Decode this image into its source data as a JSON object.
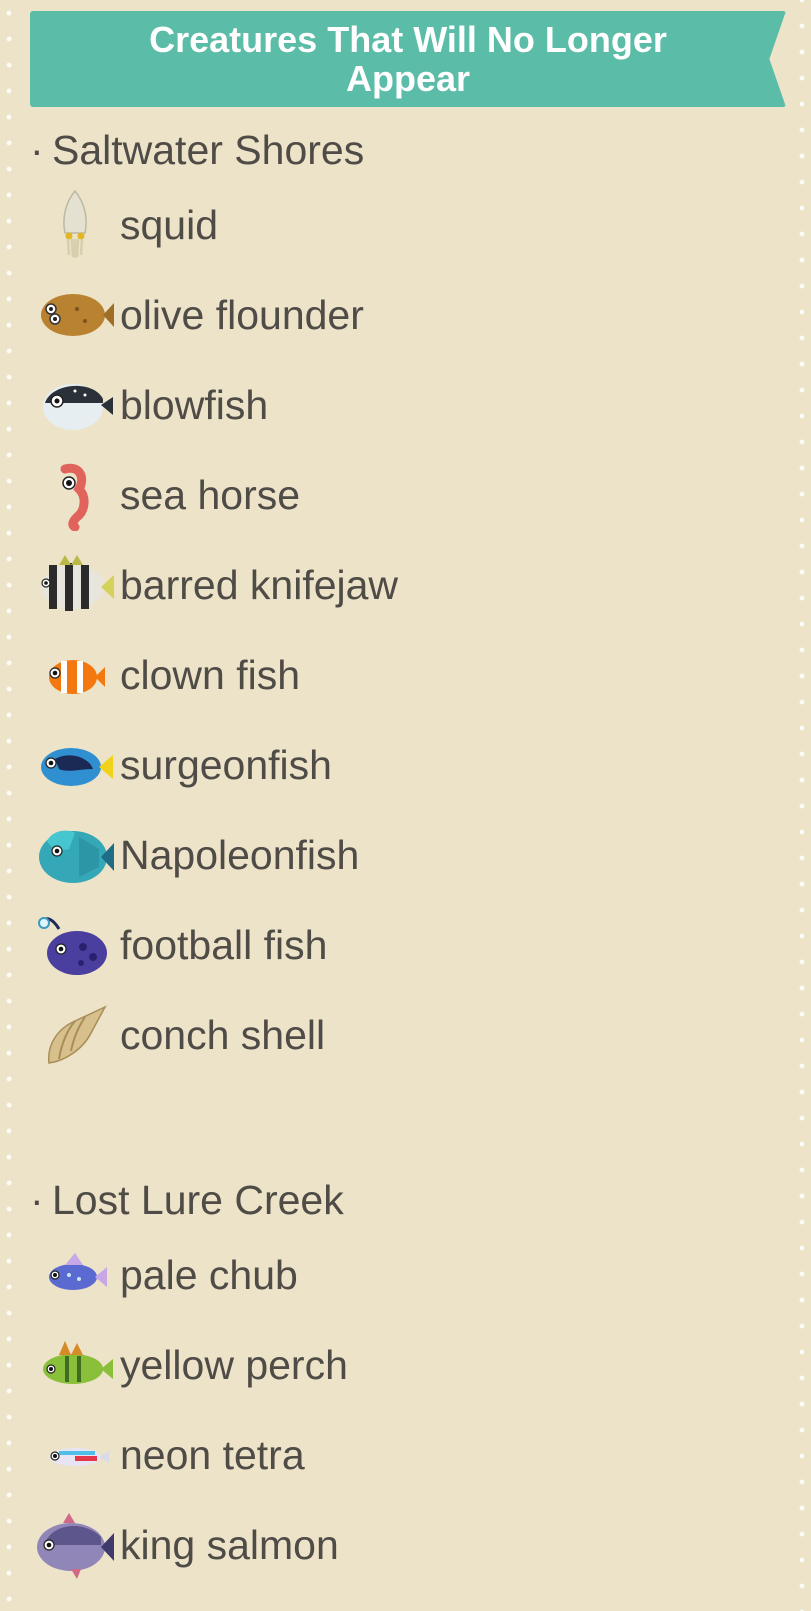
{
  "banner": {
    "title": "Creatures That Will No Longer Appear"
  },
  "sections": [
    {
      "heading": "Saltwater Shores",
      "items": [
        {
          "label": "squid",
          "icon": "squid-icon"
        },
        {
          "label": "olive flounder",
          "icon": "flounder-icon"
        },
        {
          "label": "blowfish",
          "icon": "blowfish-icon"
        },
        {
          "label": "sea horse",
          "icon": "sea-horse-icon"
        },
        {
          "label": "barred knifejaw",
          "icon": "barred-knifejaw-icon"
        },
        {
          "label": "clown fish",
          "icon": "clown-fish-icon"
        },
        {
          "label": "surgeonfish",
          "icon": "surgeonfish-icon"
        },
        {
          "label": "Napoleonfish",
          "icon": "napoleonfish-icon"
        },
        {
          "label": "football fish",
          "icon": "football-fish-icon"
        },
        {
          "label": "conch shell",
          "icon": "conch-shell-icon"
        }
      ]
    },
    {
      "heading": "Lost Lure Creek",
      "items": [
        {
          "label": "pale chub",
          "icon": "pale-chub-icon"
        },
        {
          "label": "yellow perch",
          "icon": "yellow-perch-icon"
        },
        {
          "label": "neon tetra",
          "icon": "neon-tetra-icon"
        },
        {
          "label": "king salmon",
          "icon": "king-salmon-icon"
        }
      ]
    }
  ],
  "colors": {
    "background": "#ece3c8",
    "banner": "#5bbca7",
    "text": "#4f4b47"
  }
}
